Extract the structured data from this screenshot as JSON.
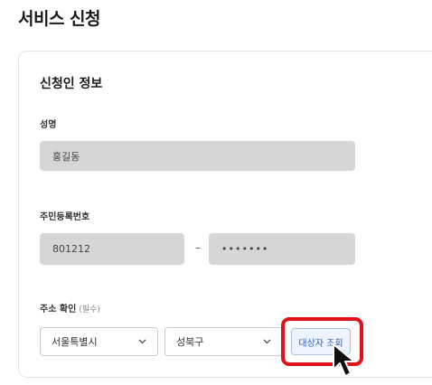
{
  "page": {
    "title": "서비스 신청"
  },
  "applicant_info": {
    "section_title": "신청인 정보",
    "name": {
      "label": "성명",
      "value": "홍길동"
    },
    "resident_number": {
      "label": "주민등록번호",
      "front_value": "801212",
      "separator": "–",
      "back_value": "•••••••"
    },
    "address": {
      "label": "주소 확인",
      "required_hint": "(필수)",
      "city_select": {
        "selected": "서울특별시"
      },
      "district_select": {
        "selected": "성북구"
      },
      "lookup_button_label": "대상자 조회"
    }
  },
  "colors": {
    "readonly_bg": "#d6d6d6",
    "button_text": "#2f5fb8",
    "button_bg": "#eef4ff",
    "highlight": "#e0131b"
  },
  "icons": {
    "select_chevron": "chevron-down-icon",
    "cursor": "mouse-pointer-icon"
  }
}
